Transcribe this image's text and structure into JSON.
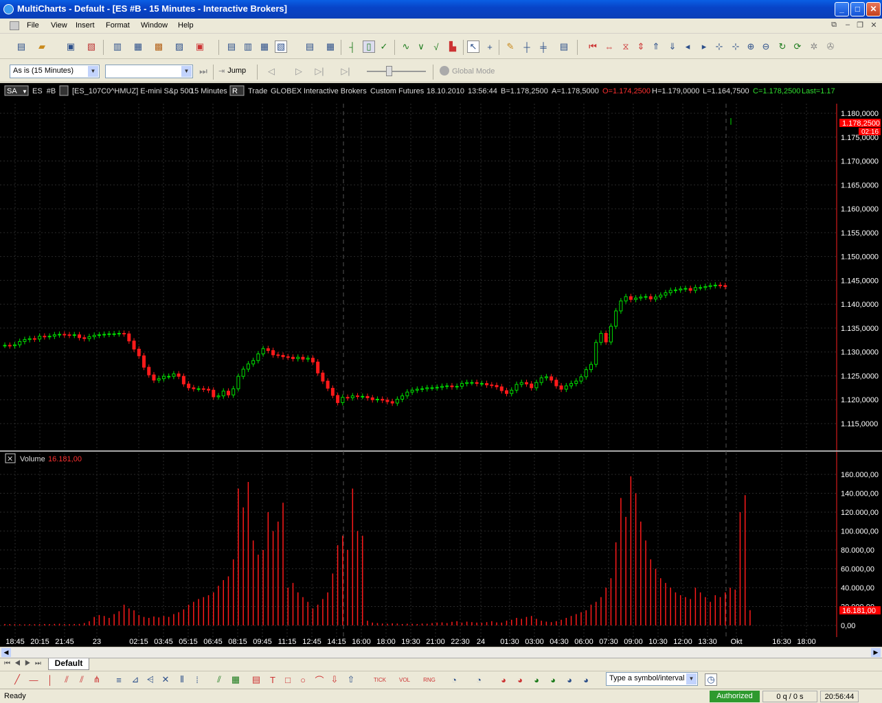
{
  "window": {
    "title": "MultiCharts - Default - [ES  #B - 15 Minutes - Interactive Brokers]"
  },
  "menu": [
    "File",
    "View",
    "Insert",
    "Format",
    "Window",
    "Help"
  ],
  "toolbar2": {
    "resolution": "As is (15 Minutes)",
    "jump_label": "Jump",
    "global_mode": "Global Mode"
  },
  "chart_header": {
    "sa": "SA",
    "symbol": "ES  #B",
    "contract": "[ES_107C0^HMUZ] E-mini S&p 500",
    "interval": "15 Minutes",
    "r": "R",
    "type": "Trade",
    "exchange": "GLOBEX",
    "broker": "Interactive Brokers",
    "custom": "Custom Futures",
    "date": "18.10.2010",
    "time": "13:56:44",
    "bid": "B=1.178,2500",
    "ask": "A=1.178,5000",
    "open": "O=1.174,2500",
    "high": "H=1.179,0000",
    "low": "L=1.164,7500",
    "close": "C=1.178,2500",
    "last": "Last=1.17"
  },
  "volume_header": {
    "label": "Volume",
    "value": "16.181,00"
  },
  "price_ticks": [
    "1.180,0000",
    "1.175,0000",
    "1.170,0000",
    "1.165,0000",
    "1.160,0000",
    "1.155,0000",
    "1.150,0000",
    "1.145,0000",
    "1.140,0000",
    "1.135,0000",
    "1.130,0000",
    "1.125,0000",
    "1.120,0000",
    "1.115,0000"
  ],
  "price_marker": {
    "value": "1.178,2500",
    "sub": "02:16"
  },
  "volume_ticks": [
    "160.000,00",
    "140.000,00",
    "120.000,00",
    "100.000,00",
    "80.000,00",
    "60.000,00",
    "40.000,00",
    "20.000,00",
    "0,00"
  ],
  "volume_marker": "16.181,00",
  "time_ticks": [
    "18:45",
    "20:15",
    "21:45",
    "23",
    "02:15",
    "03:45",
    "05:15",
    "06:45",
    "08:15",
    "09:45",
    "11:15",
    "12:45",
    "14:15",
    "16:00",
    "18:00",
    "19:30",
    "21:00",
    "22:30",
    "24",
    "01:30",
    "03:00",
    "04:30",
    "06:00",
    "07:30",
    "09:00",
    "10:30",
    "12:00",
    "13:30",
    "Okt",
    "16:30",
    "18:00"
  ],
  "tabs": {
    "active": "Default"
  },
  "symbol_box": "Type a symbol/interval",
  "status": {
    "ready": "Ready",
    "authorized": "Authorized",
    "queue": "0 q / 0 s",
    "clock": "20:56:44"
  },
  "colors": {
    "up": "#00e000",
    "down": "#ff1a1a",
    "axis_text": "#ffffff",
    "grid": "#2a2a2a",
    "marker": "#ff0000",
    "authorized": "#2e9a2e"
  },
  "chart_data": [
    {
      "type": "candlestick",
      "title": "ES  #B - 15 Minutes",
      "ylim": [
        1115,
        1181
      ],
      "series": [
        {
          "name": "ES  #B",
          "close": [
            1131.4,
            1131.3,
            1131.5,
            1132.2,
            1132.6,
            1132.8,
            1132.7,
            1133.3,
            1133.2,
            1133.3,
            1133.6,
            1133.7,
            1133.6,
            1133.5,
            1133.6,
            1133.0,
            1132.8,
            1133.2,
            1133.5,
            1133.6,
            1133.7,
            1133.8,
            1133.8,
            1133.9,
            1133.8,
            1132.3,
            1130.6,
            1129.2,
            1126.8,
            1125.2,
            1124.1,
            1124.4,
            1124.9,
            1124.9,
            1125.4,
            1124.9,
            1123.3,
            1122.5,
            1122.3,
            1122.3,
            1122.2,
            1122.0,
            1120.6,
            1120.8,
            1121.8,
            1121.0,
            1122.3,
            1124.9,
            1126.4,
            1127.5,
            1128.2,
            1129.6,
            1130.7,
            1130.3,
            1129.4,
            1129.3,
            1129.0,
            1128.9,
            1128.6,
            1128.9,
            1128.5,
            1128.7,
            1127.9,
            1125.6,
            1123.9,
            1122.4,
            1120.9,
            1119.4,
            1120.5,
            1120.4,
            1120.8,
            1120.7,
            1120.7,
            1120.4,
            1120.0,
            1120.1,
            1119.9,
            1119.6,
            1119.3,
            1120.1,
            1120.8,
            1121.6,
            1122.0,
            1122.2,
            1122.3,
            1122.5,
            1122.5,
            1122.6,
            1122.8,
            1122.9,
            1122.7,
            1122.8,
            1123.4,
            1123.6,
            1123.6,
            1123.4,
            1123.4,
            1123.1,
            1123.0,
            1122.7,
            1121.9,
            1121.3,
            1122.0,
            1123.2,
            1123.6,
            1123.3,
            1122.5,
            1123.6,
            1124.6,
            1124.8,
            1124.1,
            1122.9,
            1122.2,
            1122.9,
            1123.4,
            1123.9,
            1124.8,
            1126.3,
            1127.4,
            1132.0,
            1133.9,
            1132.1,
            1135.4,
            1138.6,
            1140.7,
            1141.6,
            1141.0,
            1141.3,
            1141.5,
            1141.6,
            1141.1,
            1141.5,
            1141.9,
            1142.4,
            1142.9,
            1143.0,
            1143.2,
            1143.3,
            1142.9,
            1143.5,
            1143.5,
            1143.7,
            1143.9,
            1144.0,
            1143.9,
            1143.7,
            1178.25
          ]
        }
      ],
      "xlabel": "",
      "ylabel": ""
    },
    {
      "type": "bar",
      "title": "Volume",
      "series": [
        {
          "name": "Volume",
          "values": [
            1500,
            1400,
            1300,
            1200,
            1100,
            1300,
            1250,
            1350,
            1500,
            1400,
            1600,
            1800,
            1400,
            1300,
            1500,
            1600,
            2500,
            4500,
            9000,
            11000,
            10000,
            8000,
            12000,
            15000,
            22000,
            18000,
            16000,
            11000,
            9000,
            8000,
            9500,
            8500,
            10000,
            9000,
            12000,
            14000,
            17000,
            22000,
            25000,
            28000,
            30000,
            32000,
            35000,
            42000,
            48000,
            52000,
            70000,
            145000,
            125000,
            152000,
            90000,
            75000,
            80000,
            120000,
            100000,
            110000,
            130000,
            40000,
            45000,
            35000,
            30000,
            25000,
            18000,
            22000,
            28000,
            35000,
            55000,
            85000,
            95000,
            80000,
            145000,
            100000,
            95000,
            5000,
            3000,
            2500,
            2000,
            1800,
            2200,
            2000,
            1500,
            1800,
            1700,
            1500,
            2000,
            1800,
            2500,
            3000,
            3200,
            2500,
            3800,
            4500,
            3000,
            4000,
            3500,
            3000,
            2800,
            3500,
            4500,
            3200,
            3000,
            5000,
            6000,
            8000,
            7000,
            9000,
            10000,
            7000,
            5000,
            4000,
            3500,
            4500,
            6000,
            8000,
            10000,
            12000,
            14000,
            16000,
            22000,
            25000,
            30000,
            40000,
            50000,
            88000,
            135000,
            115000,
            158000,
            140000,
            110000,
            90000,
            70000,
            60000,
            50000,
            45000,
            40000,
            35000,
            32000,
            30000,
            28000,
            40000,
            35000,
            30000,
            25000,
            32000,
            30000,
            35000,
            40000,
            38000,
            120000,
            138000,
            16181
          ]
        }
      ],
      "ylim": [
        0,
        170000
      ]
    }
  ]
}
